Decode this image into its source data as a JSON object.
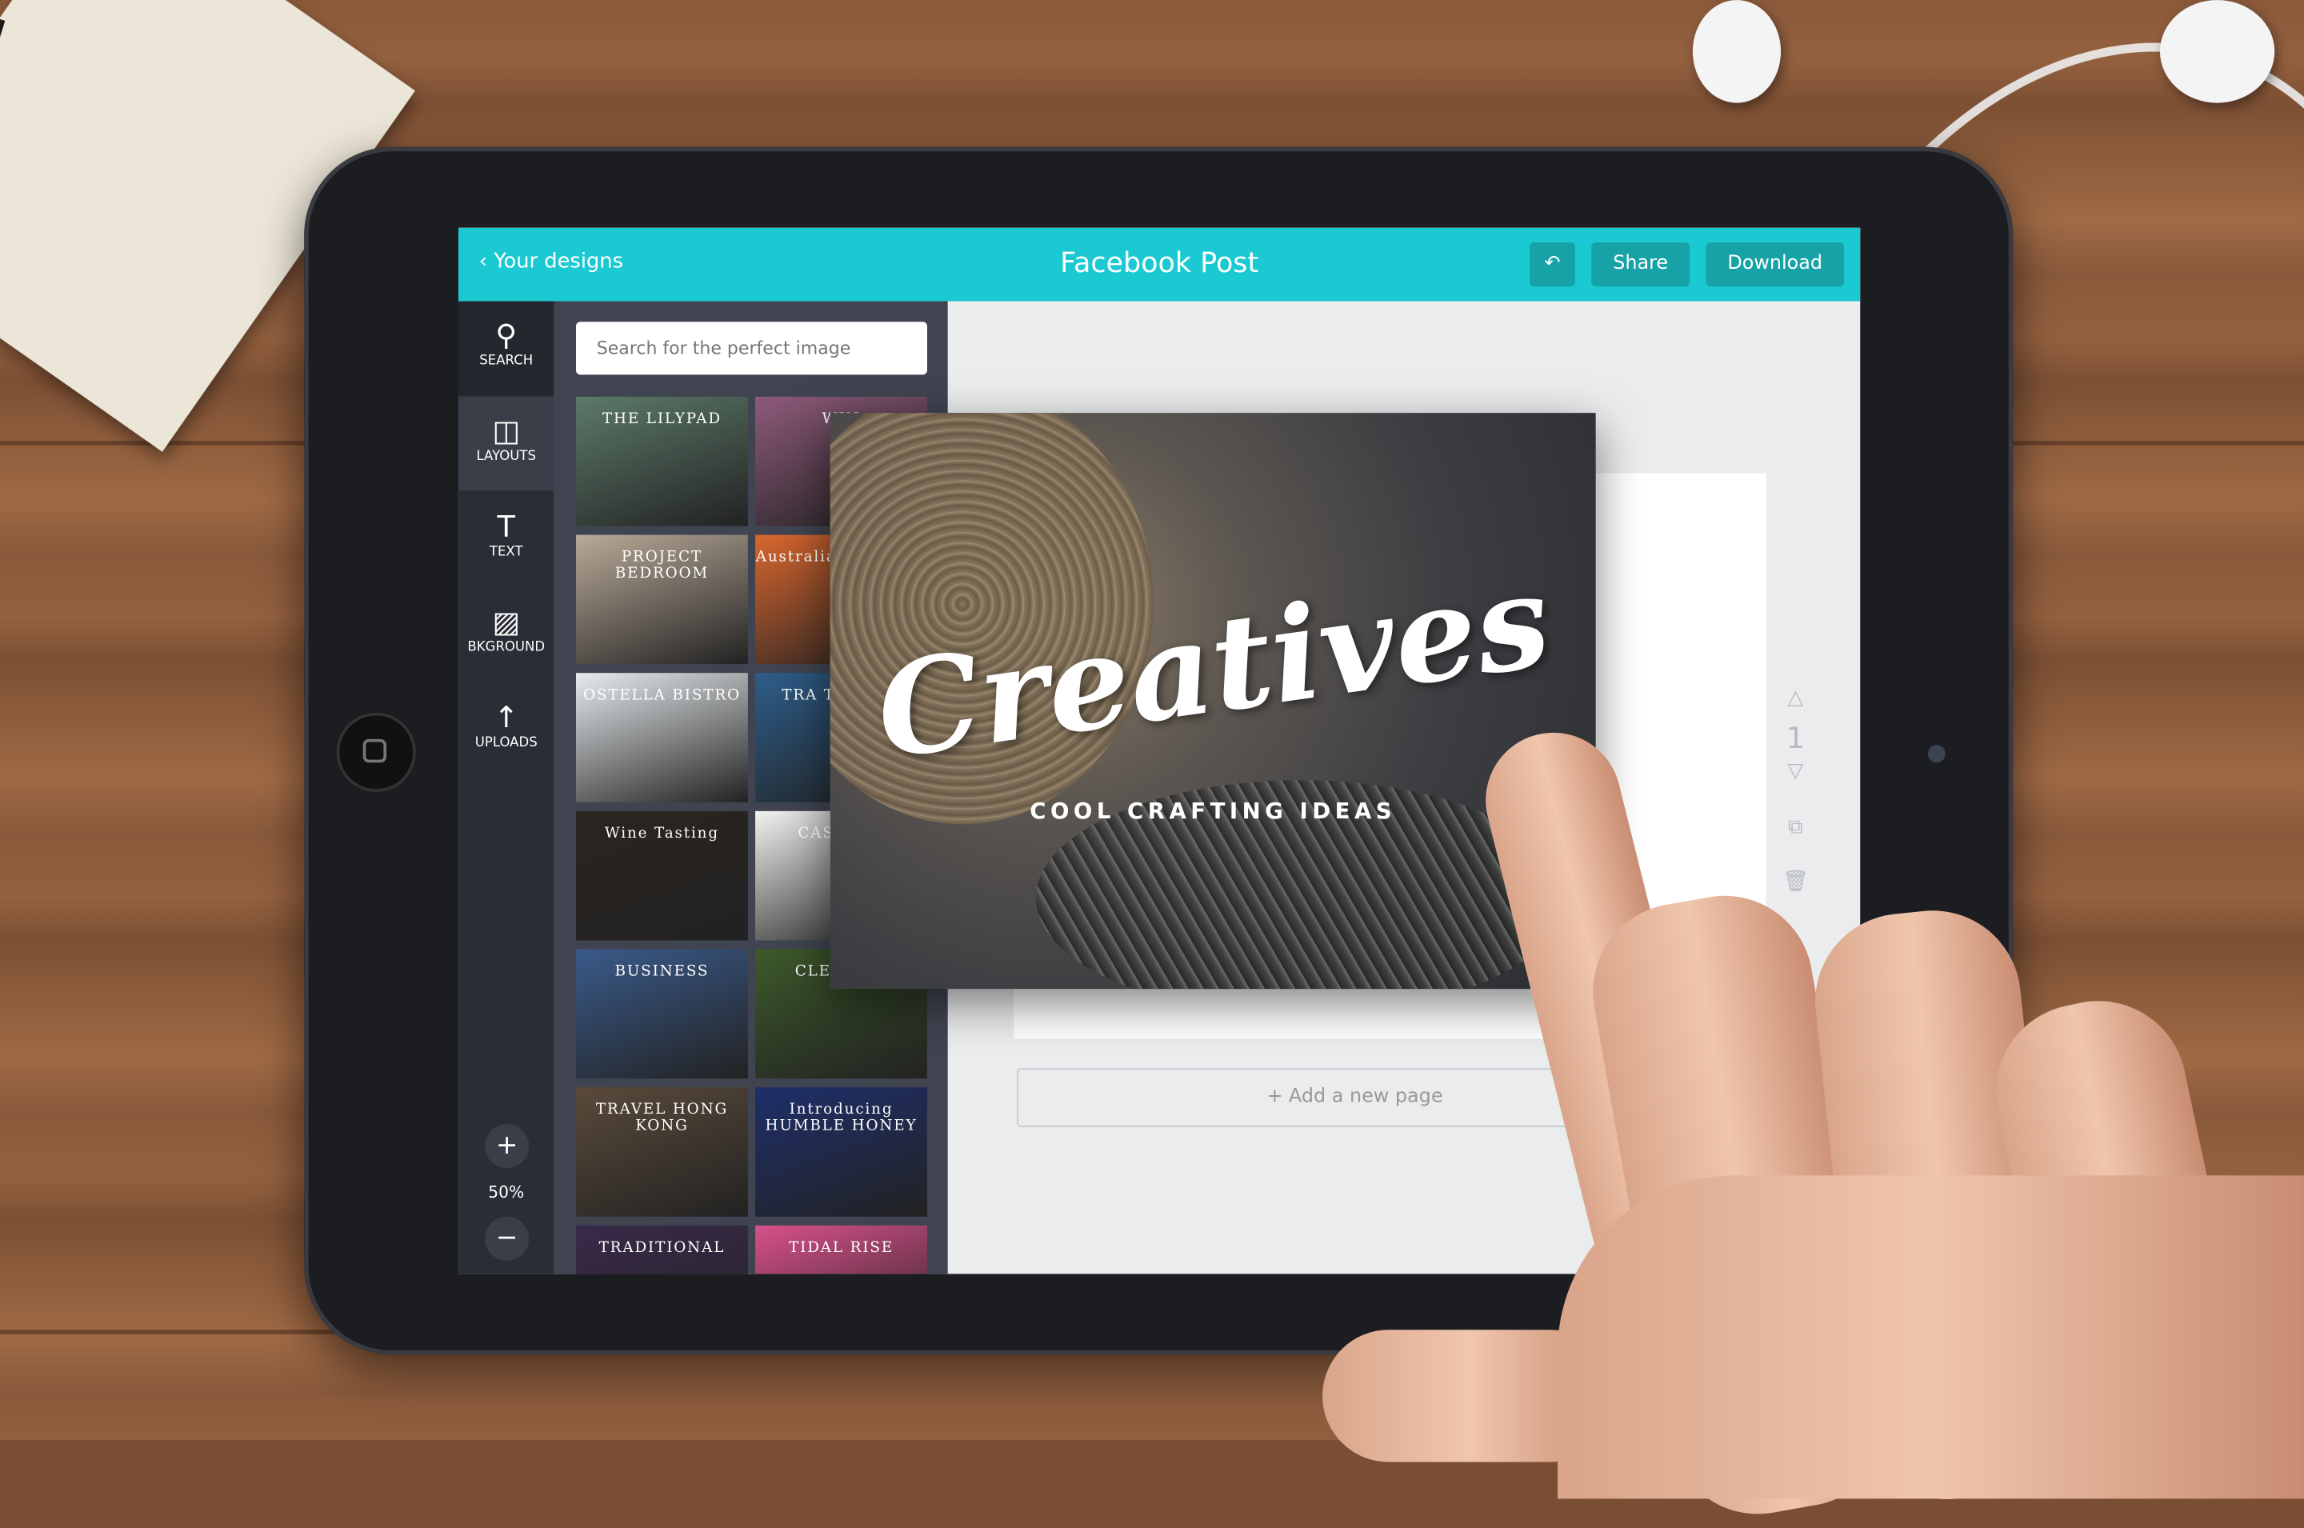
{
  "header": {
    "back_label": "‹ Your designs",
    "title": "Facebook Post",
    "undo_icon": "undo-icon",
    "share_label": "Share",
    "download_label": "Download",
    "accent": "#1ac9d2"
  },
  "sidebar": {
    "items": [
      {
        "label": "SEARCH",
        "icon": "⚲"
      },
      {
        "label": "LAYOUTS",
        "icon": "◫"
      },
      {
        "label": "TEXT",
        "icon": "T"
      },
      {
        "label": "BKGROUND",
        "icon": "▨"
      },
      {
        "label": "UPLOADS",
        "icon": "↑"
      }
    ],
    "zoom_in": "+",
    "zoom_level": "50%",
    "zoom_out": "−"
  },
  "panel": {
    "search_placeholder": "Search for the perfect image",
    "thumbnails": [
      {
        "text": "THE LILYPAD",
        "color": "#5c7a6a"
      },
      {
        "text": "WIN",
        "color": "#8e5a7a"
      },
      {
        "text": "PROJECT BEDROOM",
        "color": "#b9aa98"
      },
      {
        "text": "Australian Outback",
        "color": "#d9672e"
      },
      {
        "text": "OSTELLA BISTRO",
        "color": "#e8ecef"
      },
      {
        "text": "TRA Thailand",
        "color": "#2d5d8a"
      },
      {
        "text": "Wine Tasting",
        "color": "#2a2420"
      },
      {
        "text": "CASCADE",
        "color": "#f2f2f0"
      },
      {
        "text": "BUSINESS",
        "color": "#3a5a8a"
      },
      {
        "text": "CLE GREE",
        "color": "#3d5a2a"
      },
      {
        "text": "TRAVEL HONG KONG",
        "color": "#5a4a3a"
      },
      {
        "text": "Introducing HUMBLE HONEY",
        "color": "#1e2f6a"
      },
      {
        "text": "TRADITIONAL",
        "color": "#3a2a4a"
      },
      {
        "text": "TIDAL RISE",
        "color": "#d8508a"
      }
    ]
  },
  "canvas": {
    "add_page_label": "+ Add a new page",
    "page_number": "1",
    "design_title": "Creatives",
    "design_tagline": "COOL CRAFTING IDEAS"
  }
}
